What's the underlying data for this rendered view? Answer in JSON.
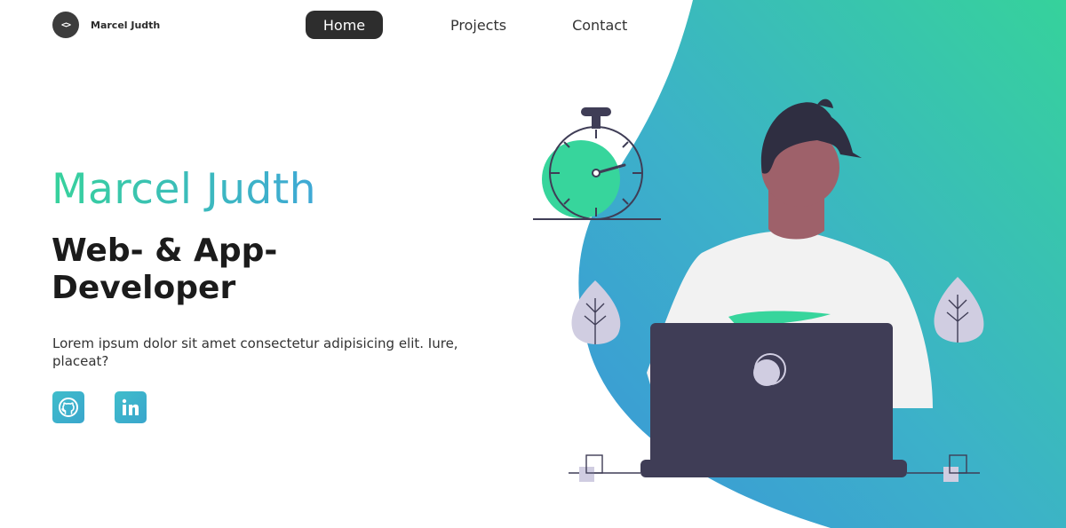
{
  "brand": {
    "logo_glyph": "<>",
    "name": "Marcel Judth"
  },
  "nav": {
    "items": [
      {
        "label": "Home",
        "active": true
      },
      {
        "label": "Projects",
        "active": false
      },
      {
        "label": "Contact",
        "active": false
      }
    ]
  },
  "hero": {
    "name": "Marcel Judth",
    "role_line1": "Web- & App-",
    "role_line2": "Developer",
    "description": "Lorem ipsum dolor sit amet consectetur adipisicing elit. Iure, placeat?"
  },
  "socials": [
    {
      "icon": "github-icon"
    },
    {
      "icon": "linkedin-icon"
    }
  ],
  "colors": {
    "accent_green": "#37d29c",
    "accent_blue": "#3fa8d6",
    "dark": "#2d2d2d",
    "laptop": "#3f3d56"
  }
}
